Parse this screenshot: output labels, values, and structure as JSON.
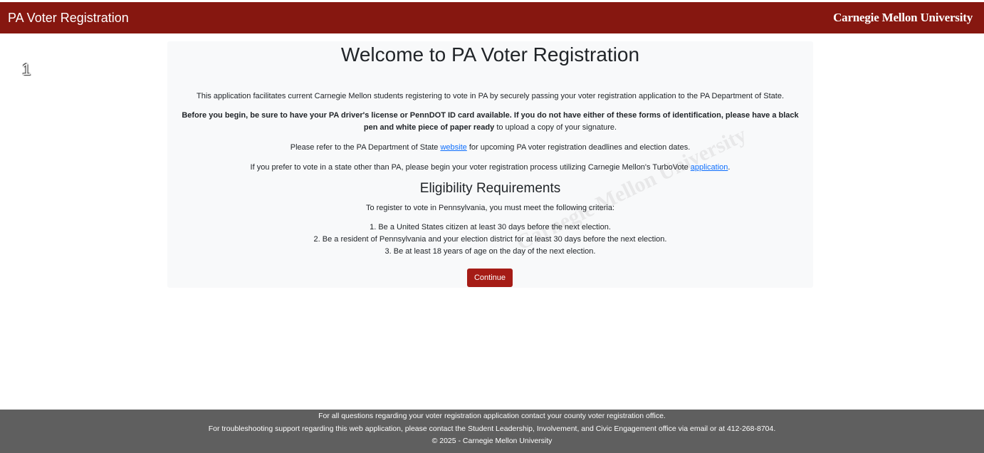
{
  "header": {
    "app_title": "PA Voter Registration",
    "brand": "Carnegie Mellon University"
  },
  "step_indicator": "1",
  "main": {
    "title": "Welcome to PA Voter Registration",
    "intro": "This application facilitates current Carnegie Mellon students registering to vote in PA by securely passing your voter registration application to the PA Department of State.",
    "before_bold": "Before you begin, be sure to have your PA driver's license or PennDOT ID card available. If you do not have either of these forms of identification, please have a black pen and white piece of paper ready",
    "before_rest": " to upload a copy of your signature.",
    "refer_pre": "Please refer to the PA Department of State ",
    "refer_link": "website",
    "refer_post": " for upcoming PA voter registration deadlines and election dates.",
    "other_state_pre": "If you prefer to vote in a state other than PA, please begin your voter registration process utilizing Carnegie Mellon's TurboVote ",
    "other_state_link": "application",
    "other_state_post": ".",
    "eligibility_title": "Eligibility Requirements",
    "eligibility_intro": "To register to vote in Pennsylvania, you must meet the following criteria:",
    "criteria": [
      "1. Be a United States citizen at least 30 days before the next election.",
      "2. Be a resident of Pennsylvania and your election district for at least 30 days before the next election.",
      "3. Be at least 18 years of age on the day of the next election."
    ],
    "continue_label": "Continue",
    "watermark": "Carnegie Mellon University"
  },
  "footer": {
    "line1": "For all questions regarding your voter registration application contact your county voter registration office.",
    "line2": "For troubleshooting support regarding this web application, please contact the Student Leadership, Involvement, and Civic Engagement office via email or at 412-268-8704.",
    "line3": "© 2025 - Carnegie Mellon University"
  },
  "colors": {
    "header_bg": "#861710",
    "button_bg": "#a51c16",
    "card_bg": "#f8f9fa",
    "footer_bg": "#5f5f5f",
    "link": "#0d6efd"
  }
}
